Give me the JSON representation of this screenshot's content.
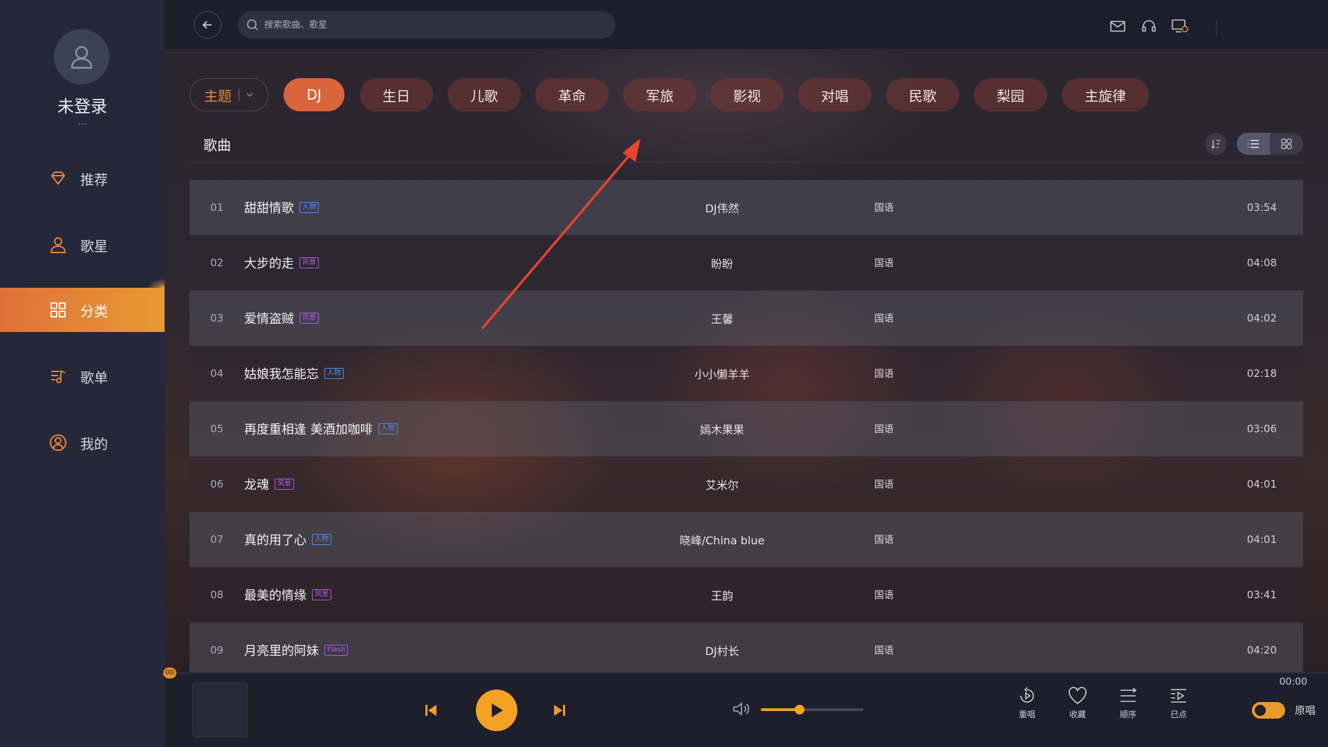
{
  "sidebar": {
    "username": "未登录",
    "user_more": "...",
    "nav": [
      {
        "label": "推荐",
        "icon": "diamond-icon"
      },
      {
        "label": "歌星",
        "icon": "person-icon"
      },
      {
        "label": "分类",
        "icon": "category-grid-icon",
        "active": true
      },
      {
        "label": "歌单",
        "icon": "playlist-icon"
      },
      {
        "label": "我的",
        "icon": "user-circle-icon"
      }
    ]
  },
  "topbar": {
    "search_placeholder": "搜索歌曲、歌星",
    "icons": [
      "mail-icon",
      "headset-icon",
      "screen-icon",
      "cast-icon",
      "download-icon",
      "power-icon"
    ]
  },
  "categories": {
    "theme_label": "主题",
    "tabs": [
      "DJ",
      "生日",
      "儿歌",
      "革命",
      "军旅",
      "影视",
      "对唱",
      "民歌",
      "梨园",
      "主旋律"
    ],
    "active_tab": "DJ"
  },
  "section": {
    "title": "歌曲"
  },
  "songs": [
    {
      "num": "01",
      "title": "甜甜情歌",
      "tag": "人物",
      "tag_color": "blue",
      "artist": "DJ伟然",
      "lang": "国语",
      "duration": "03:54"
    },
    {
      "num": "02",
      "title": "大步的走",
      "tag": "风景",
      "tag_color": "purple",
      "artist": "盼盼",
      "lang": "国语",
      "duration": "04:08"
    },
    {
      "num": "03",
      "title": "爱情盗贼",
      "tag": "风景",
      "tag_color": "purple",
      "artist": "王馨",
      "lang": "国语",
      "duration": "04:02"
    },
    {
      "num": "04",
      "title": "姑娘我怎能忘",
      "tag": "人物",
      "tag_color": "blue",
      "artist": "小小懒羊羊",
      "lang": "国语",
      "duration": "02:18"
    },
    {
      "num": "05",
      "title": "再度重相逢 美酒加咖啡",
      "tag": "人物",
      "tag_color": "blue",
      "artist": "嫣木果果",
      "lang": "国语",
      "duration": "03:06"
    },
    {
      "num": "06",
      "title": "龙魂",
      "tag": "风景",
      "tag_color": "purple",
      "artist": "艾米尔",
      "lang": "国语",
      "duration": "04:01"
    },
    {
      "num": "07",
      "title": "真的用了心",
      "tag": "人物",
      "tag_color": "blue",
      "artist": "晓峰/China blue",
      "lang": "国语",
      "duration": "04:01"
    },
    {
      "num": "08",
      "title": "最美的情缘",
      "tag": "风景",
      "tag_color": "purple",
      "artist": "王韵",
      "lang": "国语",
      "duration": "03:41"
    },
    {
      "num": "09",
      "title": "月亮里的阿妹",
      "tag": "Flash",
      "tag_color": "purple",
      "artist": "DJ村长",
      "lang": "国语",
      "duration": "04:20"
    }
  ],
  "player": {
    "progress_label": "00",
    "time": "00:00",
    "volume": 0.38,
    "actions": [
      {
        "label": "重唱",
        "icon": "replay-icon"
      },
      {
        "label": "收藏",
        "icon": "heart-icon"
      },
      {
        "label": "顺序",
        "icon": "order-icon"
      },
      {
        "label": "已点",
        "icon": "queued-icon"
      }
    ],
    "toggle_label": "原唱"
  },
  "colors": {
    "accent": "#e98b2f",
    "active_tab": "#d9653a",
    "annotation_arrow": "#e8432e"
  }
}
